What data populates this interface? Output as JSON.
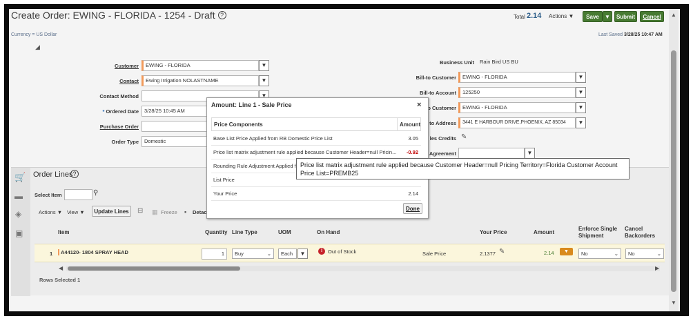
{
  "page": {
    "title": "Create Order: EWING - FLORIDA - 1254 - Draft",
    "total_label": "Total",
    "total_value": "2.14",
    "actions_label": "Actions",
    "save_label": "Save",
    "submit_label": "Submit",
    "cancel_label": "Cancel",
    "currency": "Currency = US Dollar",
    "last_saved_label": "Last Saved",
    "last_saved_value": "3/28/25 10:47 AM"
  },
  "form_left": {
    "customer_label": "Customer",
    "customer_value": "EWING - FLORIDA",
    "contact_label": "Contact",
    "contact_value": "Ewing Irrigation NOLASTNAME",
    "contact_method_label": "Contact Method",
    "contact_method_value": "",
    "ordered_date_label": "Ordered Date",
    "ordered_date_value": "3/28/25 10:45 AM",
    "purchase_order_label": "Purchase Order",
    "purchase_order_value": "",
    "order_type_label": "Order Type",
    "order_type_value": "Domestic"
  },
  "form_right": {
    "business_unit_label": "Business Unit",
    "business_unit_value": "Rain Bird US BU",
    "bill_to_customer_label": "Bill-to Customer",
    "bill_to_customer_value": "EWING - FLORIDA",
    "bill_to_account_label": "Bill-to Account",
    "bill_to_account_value": "125250",
    "ship_to_customer_label": "o Customer",
    "ship_to_customer_value": "EWING - FLORIDA",
    "ship_to_address_label": "to Address",
    "ship_to_address_value": "3441 E HARBOUR DRIVE,PHOENIX, AZ 85034",
    "sales_credits_label": "les Credits",
    "agreement_label": "Agreement",
    "agreement_value": ""
  },
  "order_lines": {
    "title": "Order Lines",
    "select_item_label": "Select Item",
    "actions_label": "Actions",
    "view_label": "View",
    "update_lines_label": "Update Lines",
    "freeze_label": "Freeze",
    "detach_label": "Detac",
    "columns": {
      "item": "Item",
      "quantity": "Quantity",
      "line_type": "Line Type",
      "uom": "UOM",
      "on_hand": "On Hand",
      "your_price": "Your Price",
      "amount": "Amount",
      "enforce_single_shipment_1": "Enforce Single",
      "enforce_single_shipment_2": "Shipment",
      "cancel_backorders_1": "Cancel",
      "cancel_backorders_2": "Backorders"
    },
    "rows": [
      {
        "num": "1",
        "item": "A44120- 1804 SPRAY HEAD",
        "quantity": "1",
        "line_type": "Buy",
        "uom": "Each",
        "on_hand": "Out of Stock",
        "price_type": "Sale Price",
        "your_price": "2.1377",
        "amount": "2.14",
        "enforce_single_shipment": "No",
        "cancel_backorders": "No"
      }
    ],
    "rows_selected_label": "Rows Selected",
    "rows_selected_value": "1"
  },
  "modal": {
    "title": "Amount: Line 1 - Sale Price",
    "close": "×",
    "col_components": "Price Components",
    "col_amount": "Amount",
    "rows": [
      {
        "desc": "Base List Price Applied from RB Domestic Price List",
        "amount": "3.05"
      },
      {
        "desc": "Price list matrix adjustment rule applied because Customer Header=null Pricin...",
        "amount": "-0.92"
      },
      {
        "desc": "Rounding Rule Adjustment Applied fr",
        "amount": ""
      },
      {
        "desc": "List Price",
        "amount": ""
      },
      {
        "desc": "Your Price",
        "amount": "2.14"
      }
    ],
    "done_label": "Done"
  },
  "tooltip": {
    "text": "Price list matrix adjustment rule applied because Customer Header=null Pricing Territory=Florida Customer Account Price List=PREMB25"
  },
  "colors": {
    "accent_green": "#477b32",
    "negative_red": "#c00000",
    "required_flag": "#f29a5a"
  }
}
